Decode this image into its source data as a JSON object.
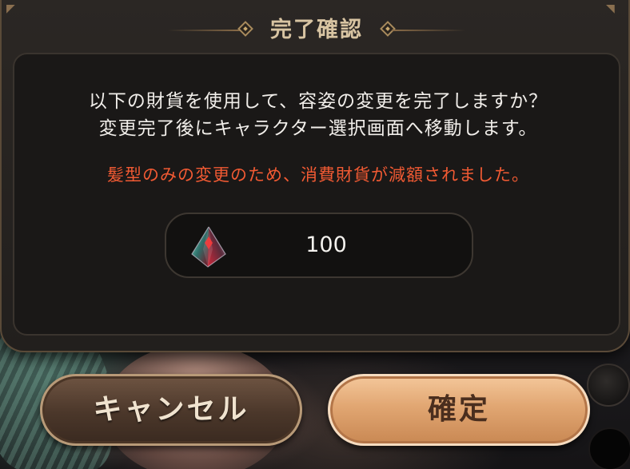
{
  "dialog": {
    "title": "完了確認",
    "message_line_1": "以下の財貨を使用して、容姿の変更を完了しますか？",
    "message_line_2": "変更完了後にキャラクター選択画面へ移動します。",
    "notice": "髪型のみの変更のため、消費財貨が減額されました。",
    "cost": {
      "icon": "gem-icon",
      "value": "100"
    }
  },
  "buttons": {
    "cancel_label": "キャンセル",
    "confirm_label": "確定"
  },
  "colors": {
    "notice_text": "#f15a33",
    "title_text": "#d8c4a2",
    "confirm_button": "#e1a672",
    "cancel_button": "#4b372a"
  }
}
